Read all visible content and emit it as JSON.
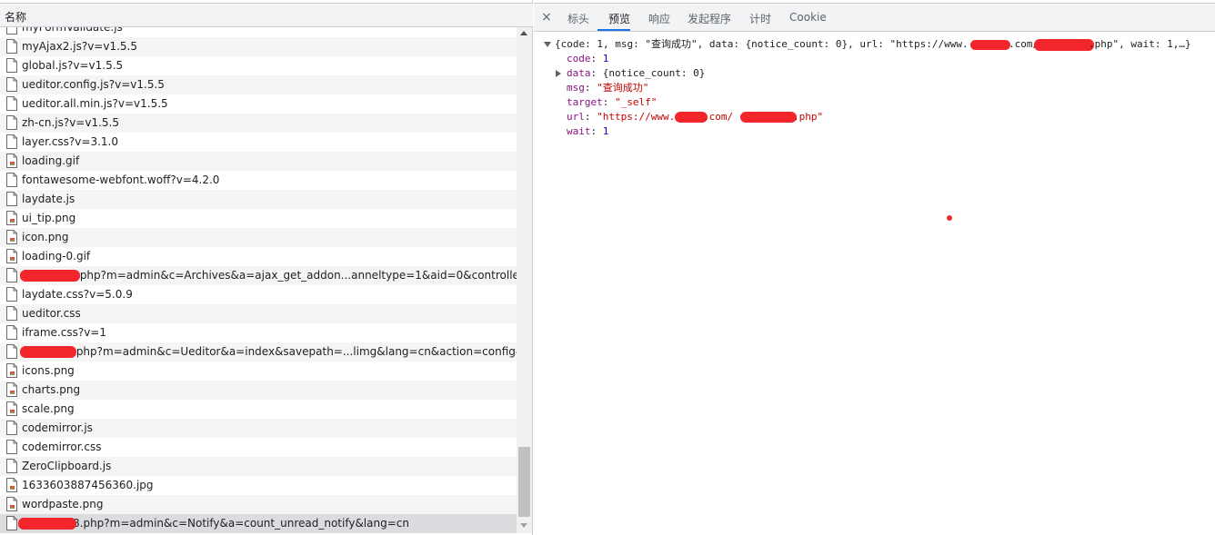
{
  "left_panel": {
    "column_header": "名称",
    "rows": [
      {
        "name": "myFormValidate.js",
        "type": "doc"
      },
      {
        "name": "myAjax2.js?v=v1.5.5",
        "type": "doc"
      },
      {
        "name": "global.js?v=v1.5.5",
        "type": "doc"
      },
      {
        "name": "ueditor.config.js?v=v1.5.5",
        "type": "doc"
      },
      {
        "name": "ueditor.all.min.js?v=v1.5.5",
        "type": "doc"
      },
      {
        "name": "zh-cn.js?v=v1.5.5",
        "type": "doc"
      },
      {
        "name": "layer.css?v=3.1.0",
        "type": "doc"
      },
      {
        "name": "loading.gif",
        "type": "image"
      },
      {
        "name": "fontawesome-webfont.woff?v=4.2.0",
        "type": "doc"
      },
      {
        "name": "laydate.js",
        "type": "doc"
      },
      {
        "name": "ui_tip.png",
        "type": "image"
      },
      {
        "name": "icon.png",
        "type": "image"
      },
      {
        "name": "loading-0.gif",
        "type": "image"
      },
      {
        "name": ".php?m=admin&c=Archives&a=ajax_get_addon...anneltype=1&aid=0&controller_name=Ar",
        "type": "doc"
      },
      {
        "name": "laydate.css?v=5.0.9",
        "type": "doc"
      },
      {
        "name": "ueditor.css",
        "type": "doc"
      },
      {
        "name": "iframe.css?v=1",
        "type": "doc"
      },
      {
        "name": ".php?m=admin&c=Ueditor&a=index&savepath=...limg&lang=cn&action=config&&noCac",
        "type": "doc"
      },
      {
        "name": "icons.png",
        "type": "image"
      },
      {
        "name": "charts.png",
        "type": "image"
      },
      {
        "name": "scale.png",
        "type": "image"
      },
      {
        "name": "codemirror.js",
        "type": "doc"
      },
      {
        "name": "codemirror.css",
        "type": "doc"
      },
      {
        "name": "ZeroClipboard.js",
        "type": "doc"
      },
      {
        "name": "1633603887456360.jpg",
        "type": "image"
      },
      {
        "name": "wordpaste.png",
        "type": "image"
      },
      {
        "name": "8.php?m=admin&c=Notify&a=count_unread_notify&lang=cn",
        "type": "doc"
      }
    ]
  },
  "right_panel": {
    "close_glyph": "×",
    "tabs": [
      {
        "label": "标头",
        "active": false
      },
      {
        "label": "预览",
        "active": true
      },
      {
        "label": "响应",
        "active": false
      },
      {
        "label": "发起程序",
        "active": false
      },
      {
        "label": "计时",
        "active": false
      },
      {
        "label": "Cookie",
        "active": false
      }
    ],
    "preview": {
      "summary_pre": "{code: 1, msg: \"查询成功\", data: {notice_count: 0}, url: \"https://www.",
      "summary_mid": ".com/",
      "summary_post": ".php\", wait: 1,…}",
      "code_key": "code",
      "code_value": "1",
      "data_key": "data",
      "data_value": "{notice_count: 0}",
      "msg_key": "msg",
      "msg_value": "\"查询成功\"",
      "target_key": "target",
      "target_value": "\"_self\"",
      "url_key": "url",
      "url_pre": "\"https://www.",
      "url_mid": ".com/",
      "url_post": ".php\"",
      "wait_key": "wait",
      "wait_value": "1"
    }
  },
  "colors": {
    "accent": "#1a73e8",
    "redaction": "#f2262b",
    "json_key": "#881280",
    "json_string": "#c80000",
    "json_number": "#1c00cf"
  }
}
